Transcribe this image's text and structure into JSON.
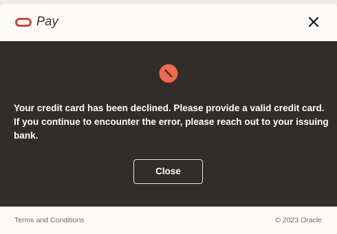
{
  "header": {
    "brand": "Pay",
    "logo_icon": "oracle-logo",
    "close_icon": "close-icon"
  },
  "message": {
    "status_icon": "error-icon",
    "text": "Your credit card has been declined. Please provide a valid credit card. If you continue to encounter the error, please reach out to your issuing bank.",
    "button_label": "Close"
  },
  "footer": {
    "terms_label": "Terms and Conditions",
    "copyright": "© 2023 Oracle"
  },
  "colors": {
    "brand_red": "#c74634",
    "error_icon": "#f06a4f",
    "dialog_body": "#312d2a"
  }
}
